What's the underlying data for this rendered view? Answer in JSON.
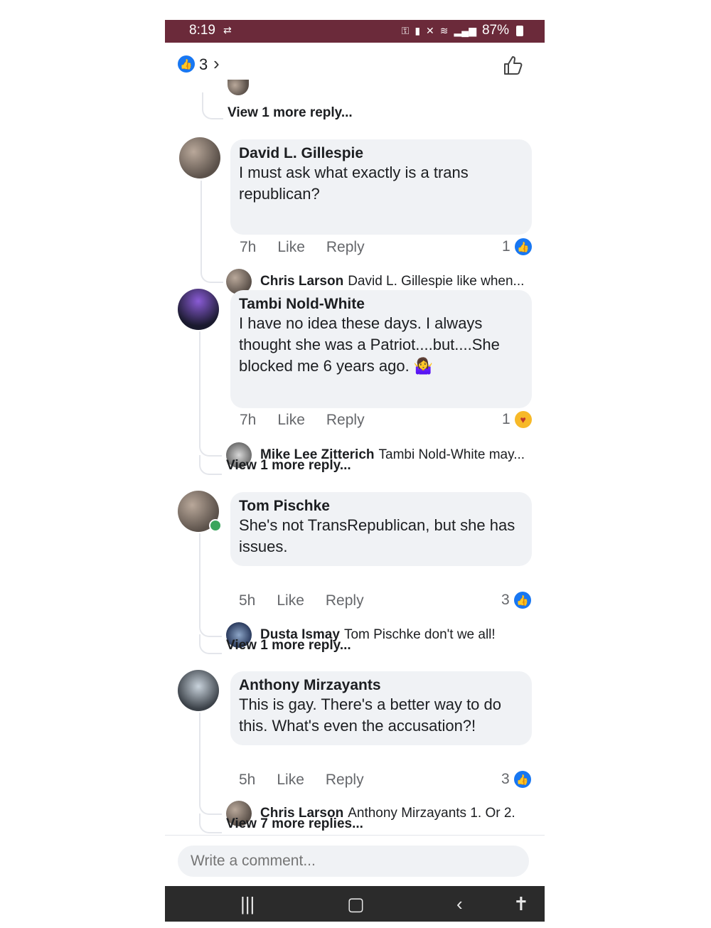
{
  "status": {
    "time": "8:19",
    "battery": "87%"
  },
  "header": {
    "reaction_count": "3"
  },
  "top_view_more": "View 1 more reply...",
  "comments": [
    {
      "author": "David L. Gillespie",
      "text": "I must ask what exactly is a trans republican?",
      "time": "7h",
      "like": "Like",
      "reply": "Reply",
      "reactions": "1",
      "reply_preview": {
        "name": "Chris Larson",
        "text": "David L. Gillespie like when..."
      }
    },
    {
      "author": "Tambi Nold-White",
      "text": "I have no idea these days. I always thought she was a Patriot....but....She blocked me 6 years ago. 🤷‍♀️",
      "time": "7h",
      "like": "Like",
      "reply": "Reply",
      "reactions": "1",
      "reply_preview": {
        "name": "Mike Lee Zitterich",
        "text": "Tambi Nold-White may..."
      },
      "view_more": "View 1 more reply..."
    },
    {
      "author": "Tom Pischke",
      "text": "She's not TransRepublican, but she has issues.",
      "time": "5h",
      "like": "Like",
      "reply": "Reply",
      "reactions": "3",
      "reply_preview": {
        "name": "Dusta Ismay",
        "text": "Tom Pischke don't we all!"
      },
      "view_more": "View 1 more reply..."
    },
    {
      "author": "Anthony Mirzayants",
      "text": "This is gay. There's a better way to do this. What's even the accusation?!",
      "time": "5h",
      "like": "Like",
      "reply": "Reply",
      "reactions": "3",
      "reply_preview": {
        "name": "Chris Larson",
        "text": "Anthony Mirzayants 1. Or 2."
      },
      "view_more": "View 7 more replies..."
    }
  ],
  "composer": {
    "placeholder": "Write a comment..."
  },
  "icons": {
    "like": "thumbs-up-icon",
    "hug": "care-reaction-icon",
    "back": "back-icon",
    "home": "home-icon",
    "recents": "recents-icon",
    "accessibility": "accessibility-icon"
  },
  "colors": {
    "status_bar": "#6b2a3a",
    "like_blue": "#1877f2",
    "bubble": "#f0f2f5",
    "online": "#3ba55c"
  }
}
